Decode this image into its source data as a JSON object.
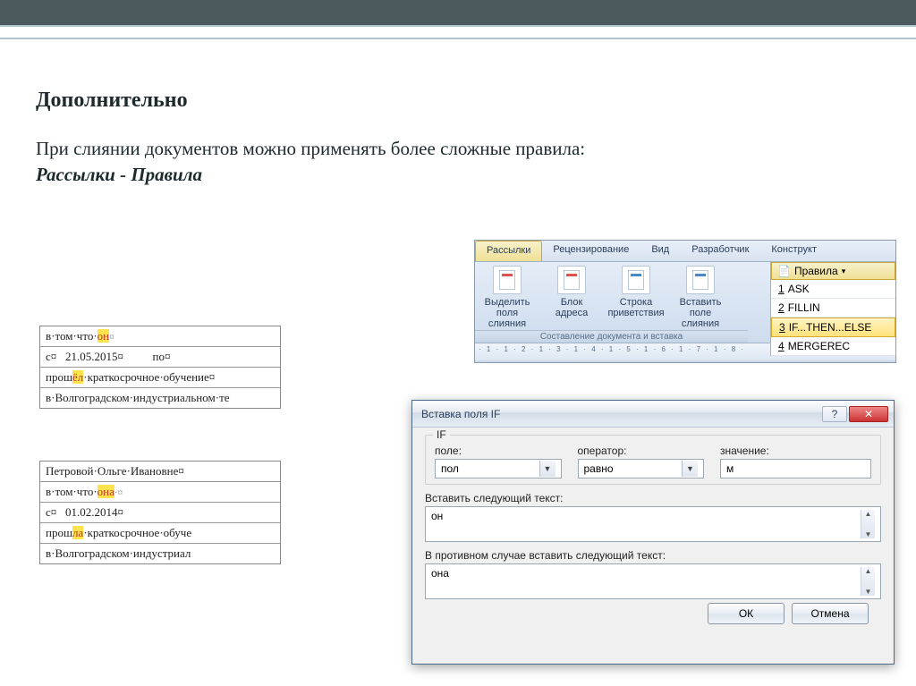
{
  "heading": "Дополнительно",
  "intro": "При слиянии документов можно применять более сложные правила:",
  "path": "Рассылки - Правила",
  "doc1": {
    "r1_a": "в·том·что·",
    "r1_hl": "он",
    "r1_b": "¤",
    "r2_a": "с¤",
    "r2_date": "21.05.2015¤",
    "r2_b": "по¤",
    "r3_a": "прош",
    "r3_hl": "ёл",
    "r3_b": "·краткосрочное·обучение¤",
    "r4": "в·Волгоградском·индустриальном·те"
  },
  "doc2": {
    "r0": "Петровой·Ольге·Ивановне¤",
    "r1_a": "в·том·что·",
    "r1_hl": "она",
    "r1_b": "·¤",
    "r2_a": "с¤",
    "r2_date": "01.02.2014¤",
    "r3_a": "прош",
    "r3_hl": "ла",
    "r3_b": "·краткосрочное·обуче",
    "r4": "в·Волгоградском·индустриал"
  },
  "ribbon": {
    "tabs": [
      "Рассылки",
      "Рецензирование",
      "Вид",
      "Разработчик",
      "Конструкт"
    ],
    "btns": [
      "Выделить поля слияния",
      "Блок адреса",
      "Строка приветствия",
      "Вставить поле слияния"
    ],
    "group": "Составление документа и вставка",
    "rules_label": "Правила",
    "rules_items": [
      {
        "num": "1",
        "label": "ASK"
      },
      {
        "num": "2",
        "label": "FILLIN"
      },
      {
        "num": "3",
        "label": "IF...THEN...ELSE"
      },
      {
        "num": "4",
        "label": "MERGEREC"
      }
    ],
    "ruler": "· 1 · 1 · 2 · 1 · 3 · 1 · 4 · 1 · 5 · 1 · 6 · 1 · 7 · 1 · 8 ·"
  },
  "dialog": {
    "title": "Вставка поля IF",
    "fieldset_label": "IF",
    "field_lbl": "поле:",
    "field_val": "пол",
    "op_lbl": "оператор:",
    "op_val": "равно",
    "val_lbl": "значение:",
    "val_val": "м",
    "then_lbl": "Вставить следующий текст:",
    "then_val": "он",
    "else_lbl": "В противном случае вставить следующий текст:",
    "else_val": "она",
    "ok": "ОК",
    "cancel": "Отмена",
    "help": "?",
    "close": "✕"
  }
}
